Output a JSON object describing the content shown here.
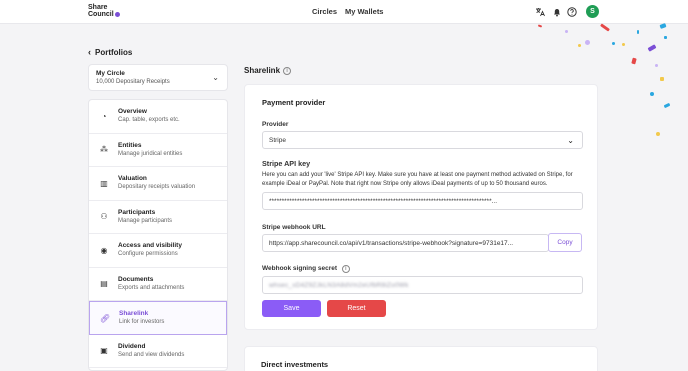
{
  "brand": {
    "name_line1": "Share",
    "name_line2": "Council",
    "accent": "#7b4fd6"
  },
  "nav": {
    "circles": "Circles",
    "wallets": "My Wallets"
  },
  "user": {
    "avatar_initial": "S"
  },
  "back_link": "Portfolios",
  "circle": {
    "name": "My Circle",
    "subtitle": "10,000 Depositary Receipts"
  },
  "menu": [
    {
      "title": "Overview",
      "subtitle": "Cap. table, exports etc.",
      "icon": "pie-chart-icon"
    },
    {
      "title": "Entities",
      "subtitle": "Manage juridical entities",
      "icon": "entities-icon"
    },
    {
      "title": "Valuation",
      "subtitle": "Depositary receipts valuation",
      "icon": "bar-chart-icon"
    },
    {
      "title": "Participants",
      "subtitle": "Manage participants",
      "icon": "people-icon"
    },
    {
      "title": "Access and visibility",
      "subtitle": "Configure permissions",
      "icon": "eye-settings-icon"
    },
    {
      "title": "Documents",
      "subtitle": "Exports and attachments",
      "icon": "document-icon"
    },
    {
      "title": "Sharelink",
      "subtitle": "Link for investors",
      "icon": "link-icon",
      "active": true
    },
    {
      "title": "Dividend",
      "subtitle": "Send and view dividends",
      "icon": "money-icon"
    }
  ],
  "page": {
    "title": "Sharelink",
    "payment_provider": "Payment provider",
    "provider_label": "Provider",
    "provider_value": "Stripe",
    "api_key_label": "Stripe API key",
    "api_key_help": "Here you can add your 'live' Stripe API key. Make sure you have at least one payment method activated on Stripe, for example iDeal or PayPal. Note that right now Stripe only allows iDeal payments of up to 50 thousand euros.",
    "api_key_value": "****************************************************************************************...",
    "webhook_label": "Stripe webhook URL",
    "webhook_value": "https://app.sharecouncil.co/api/v1/transactions/stripe-webhook?signature=9731e17...",
    "copy_label": "Copy",
    "signing_label": "Webhook signing secret",
    "signing_value": "whsec_sD4Z9ZJkLN3A8dVm2eUfbR8iZo0Wk",
    "save_label": "Save",
    "reset_label": "Reset",
    "direct_investments": "Direct investments"
  },
  "colors": {
    "primary": "#8b5cf6",
    "danger": "#e54848",
    "avatar": "#1f9d55"
  }
}
